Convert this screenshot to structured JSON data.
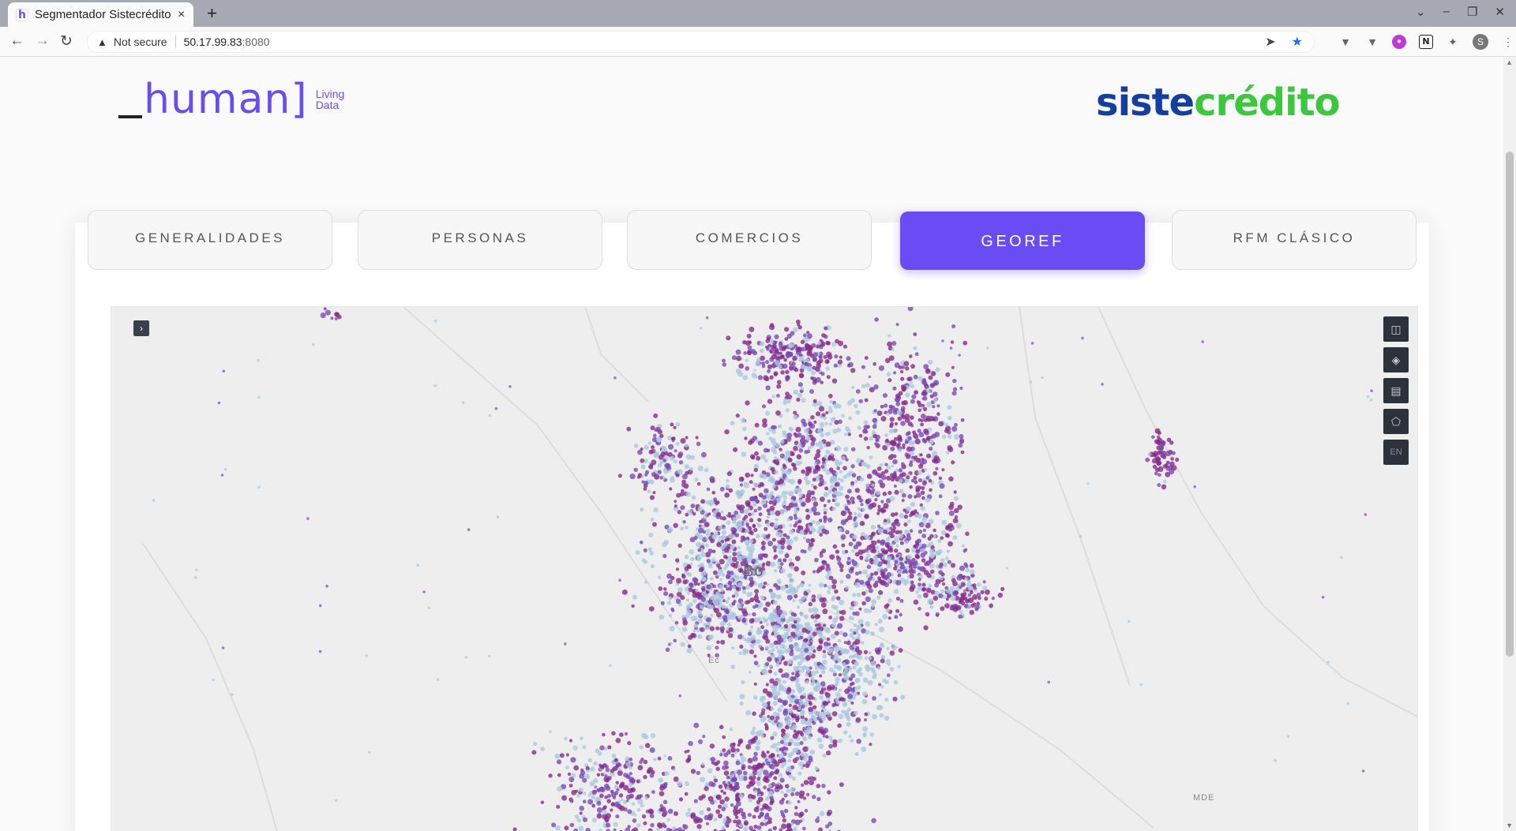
{
  "browser": {
    "tab_title": "Segmentador Sistecrédito",
    "tab_favicon": "h",
    "tab_close": "×",
    "new_tab": "+",
    "window_controls": [
      "⌄",
      "–",
      "❐",
      "✕"
    ],
    "not_secure": "Not secure",
    "url_host": "50.17.99.83",
    "url_port": ":8080",
    "profile_initial": "S"
  },
  "header": {
    "human_logo_word": "human",
    "human_logo_brackets": "]",
    "living_data_line1": "Living",
    "living_data_line2": "Data",
    "sistecredito_part1": "siste",
    "sistecredito_part2": "crédito"
  },
  "nav_tabs": [
    {
      "label": "GENERALIDADES",
      "active": false
    },
    {
      "label": "PERSONAS",
      "active": false
    },
    {
      "label": "COMERCIOS",
      "active": false
    },
    {
      "label": "GEOREF",
      "active": true
    },
    {
      "label": "RFM CLÁSICO",
      "active": false
    }
  ],
  "map": {
    "toggle_label": "›",
    "controls": [
      {
        "icon": "split-view-icon",
        "glyph": "◫"
      },
      {
        "icon": "layers-icon",
        "glyph": "◈"
      },
      {
        "icon": "table-icon",
        "glyph": "▤"
      },
      {
        "icon": "draw-polygon-icon",
        "glyph": "⬠"
      },
      {
        "icon": "language-icon",
        "glyph": "EN"
      }
    ],
    "place_labels": [
      "Bo",
      "Ec",
      "MDE"
    ],
    "colors": {
      "dense": "#8a2a8a",
      "mid": "#7a4ab8",
      "light": "#a9c8e0"
    }
  },
  "colors": {
    "accent": "#6a4cf5",
    "sistecredito_blue": "#143fa0",
    "sistecredito_green": "#3cc83c"
  }
}
